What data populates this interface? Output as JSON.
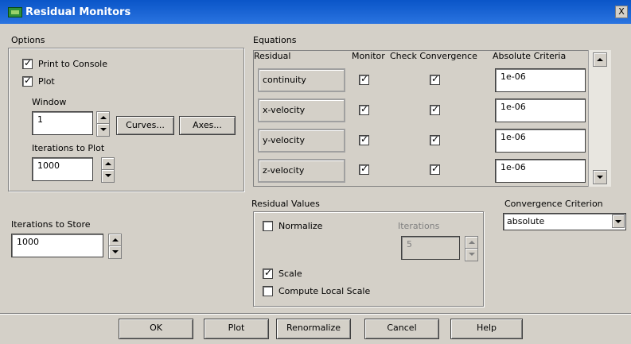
{
  "window": {
    "title": "Residual Monitors",
    "close_glyph": "X"
  },
  "options": {
    "heading": "Options",
    "print_to_console": {
      "label": "Print to Console",
      "checked": true
    },
    "plot": {
      "label": "Plot",
      "checked": true
    },
    "window_label": "Window",
    "window_value": "1",
    "curves_label": "Curves...",
    "axes_label": "Axes...",
    "iterations_to_plot_label": "Iterations to Plot",
    "iterations_to_plot_value": "1000"
  },
  "store": {
    "label": "Iterations to Store",
    "value": "1000"
  },
  "equations": {
    "heading": "Equations",
    "columns": {
      "residual": "Residual",
      "monitor": "Monitor",
      "check_convergence": "Check Convergence",
      "absolute_criteria": "Absolute Criteria"
    },
    "rows": [
      {
        "residual": "continuity",
        "monitor": true,
        "check": true,
        "criteria": "1e-06"
      },
      {
        "residual": "x-velocity",
        "monitor": true,
        "check": true,
        "criteria": "1e-06"
      },
      {
        "residual": "y-velocity",
        "monitor": true,
        "check": true,
        "criteria": "1e-06"
      },
      {
        "residual": "z-velocity",
        "monitor": true,
        "check": true,
        "criteria": "1e-06"
      }
    ]
  },
  "residual_values": {
    "heading": "Residual Values",
    "normalize": {
      "label": "Normalize",
      "checked": false
    },
    "iterations_label": "Iterations",
    "iterations_value": "5",
    "scale": {
      "label": "Scale",
      "checked": true
    },
    "compute_local_scale": {
      "label": "Compute Local Scale",
      "checked": false
    }
  },
  "convergence_criterion": {
    "label": "Convergence Criterion",
    "selected": "absolute"
  },
  "buttons": {
    "ok": "OK",
    "plot": "Plot",
    "renormalize": "Renormalize",
    "cancel": "Cancel",
    "help": "Help"
  },
  "icons": {
    "app": "fluent-app-icon",
    "close": "close-icon"
  },
  "colors": {
    "titlebar": "#0a55c8",
    "dialog_bg": "#d4d0c8",
    "field_bg": "#ffffff"
  }
}
